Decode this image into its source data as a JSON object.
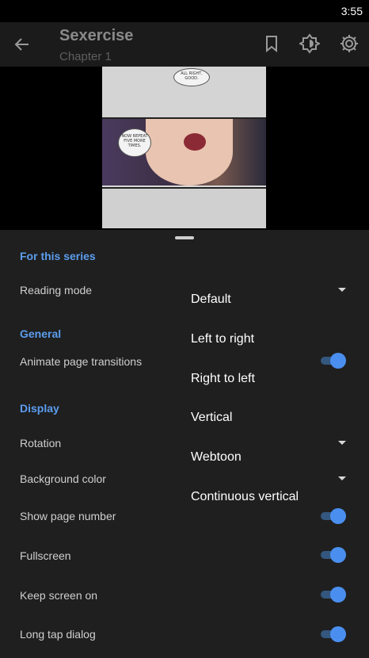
{
  "status_bar": {
    "time": "3:55"
  },
  "app_bar": {
    "title": "Sexercise",
    "subtitle": "Chapter 1",
    "icons": [
      "back-arrow-icon",
      "bookmark-icon",
      "brightness-icon",
      "settings-icon"
    ]
  },
  "page_preview": {
    "bubble_1": "ALL RIGHT, GOOD.",
    "bubble_2": "NOW REPEAT FIVE MORE TIMES."
  },
  "settings": {
    "section_series": "For this series",
    "reading_mode_label": "Reading mode",
    "section_general": "General",
    "animate_label": "Animate page transitions",
    "section_display": "Display",
    "rotation_label": "Rotation",
    "background_label": "Background color",
    "page_number_label": "Show page number",
    "fullscreen_label": "Fullscreen",
    "keep_screen_label": "Keep screen on",
    "long_tap_label": "Long tap dialog"
  },
  "reading_mode_menu": {
    "options": [
      "Default",
      "Left to right",
      "Right to left",
      "Vertical",
      "Webtoon",
      "Continuous vertical"
    ]
  },
  "colors": {
    "accent": "#4a8ff0",
    "section": "#5b9dee",
    "sheet": "#1f1f1f",
    "app_bar": "#1b1b1b"
  }
}
